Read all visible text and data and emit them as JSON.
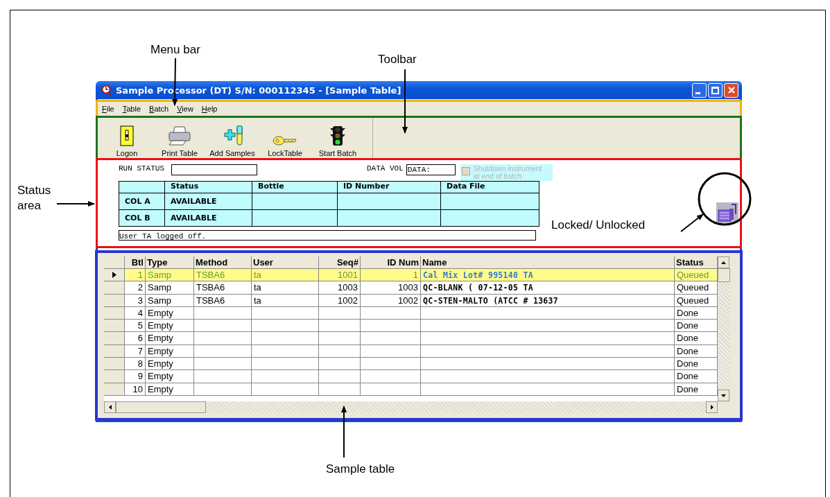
{
  "callouts": {
    "menu_bar": "Menu bar",
    "toolbar": "Toolbar",
    "status_area": "Status area",
    "lock": "Locked/ Unlocked",
    "sample_table": "Sample table"
  },
  "window": {
    "title": "Sample Processor (DT)   S/N: 000112345 - [Sample Table]"
  },
  "menu": [
    "File",
    "Table",
    "Batch",
    "View",
    "Help"
  ],
  "toolbar": [
    {
      "label": "Logon",
      "kind": "switch"
    },
    {
      "label": "Print Table",
      "kind": "printer"
    },
    {
      "label": "Add Samples",
      "kind": "add"
    },
    {
      "label": "LockTable",
      "kind": "key"
    },
    {
      "label": "Start Batch",
      "kind": "light"
    }
  ],
  "status_area": {
    "run_status_label": "RUN STATUS",
    "data_vol_label": "DATA VOL",
    "data_vol_value": "DATA:",
    "shutdown": {
      "label": "Shutdown instrument at end of batch",
      "checked": false,
      "disabled": true
    },
    "columns": [
      "Status",
      "Bottle",
      "ID Number",
      "Data File"
    ],
    "rows": [
      {
        "name": "COL A",
        "status": "AVAILABLE"
      },
      {
        "name": "COL B",
        "status": "AVAILABLE"
      }
    ],
    "message": "User TA logged off."
  },
  "sample_table": {
    "columns": [
      "Btl",
      "Type",
      "Method",
      "User",
      "Seq#",
      "ID Num",
      "Name",
      "Status"
    ],
    "rows": [
      {
        "btl": "1",
        "type": "Samp",
        "method": "TSBA6",
        "user": "ta",
        "seq": "1001",
        "id_num": "1",
        "name": "Cal Mix Lot# 995140 TA",
        "status": "Queued",
        "selected": true
      },
      {
        "btl": "2",
        "type": "Samp",
        "method": "TSBA6",
        "user": "ta",
        "seq": "1003",
        "id_num": "1003",
        "name": "QC-BLANK ( 07-12-05 TA",
        "status": "Queued",
        "selected": false
      },
      {
        "btl": "3",
        "type": "Samp",
        "method": "TSBA6",
        "user": "ta",
        "seq": "1002",
        "id_num": "1002",
        "name": "QC-STEN-MALTO (ATCC # 13637",
        "status": "Queued",
        "selected": false
      },
      {
        "btl": "4",
        "type": "Empty",
        "status": "Done",
        "selected": false
      },
      {
        "btl": "5",
        "type": "Empty",
        "status": "Done",
        "selected": false
      },
      {
        "btl": "6",
        "type": "Empty",
        "status": "Done",
        "selected": false
      },
      {
        "btl": "7",
        "type": "Empty",
        "status": "Done",
        "selected": false
      },
      {
        "btl": "8",
        "type": "Empty",
        "status": "Done",
        "selected": false
      },
      {
        "btl": "9",
        "type": "Empty",
        "status": "Done",
        "selected": false
      },
      {
        "btl": "10",
        "type": "Empty",
        "status": "Done",
        "selected": false
      }
    ]
  }
}
